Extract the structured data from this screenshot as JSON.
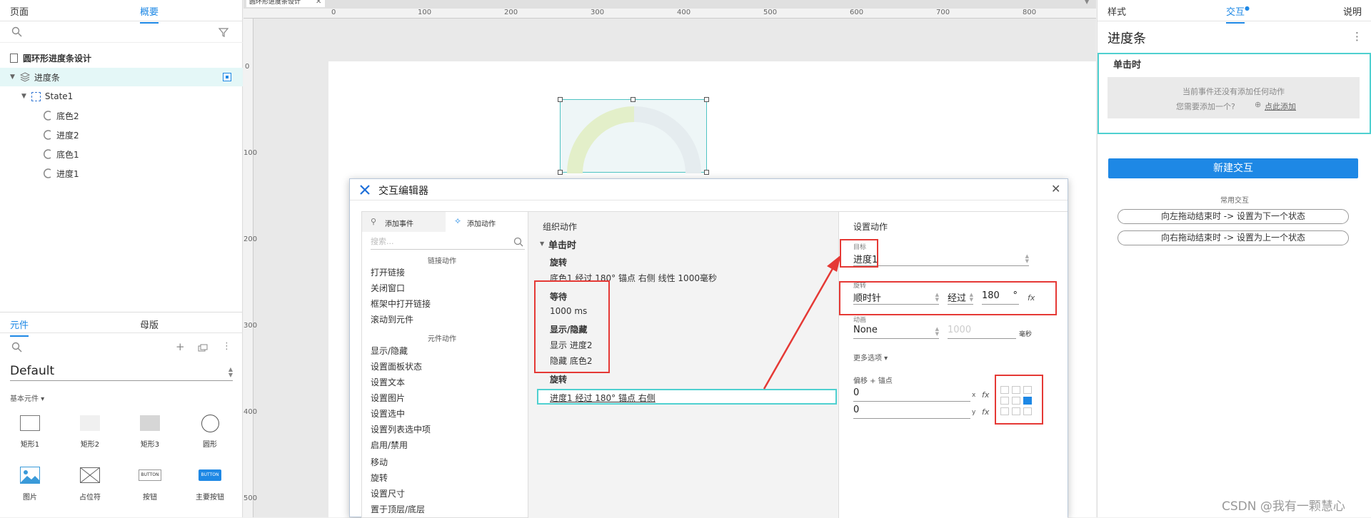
{
  "left_panel": {
    "tabs": [
      "页面",
      "概要"
    ],
    "outline": {
      "root": "圆环形进度条设计",
      "selected": "进度条",
      "state": "State1",
      "items": [
        "底色2",
        "进度2",
        "底色1",
        "进度1"
      ]
    },
    "library_tabs": [
      "元件",
      "母版"
    ],
    "library_name": "Default",
    "basic_label": "基本元件 ▾",
    "widgets": [
      "矩形1",
      "矩形2",
      "矩形3",
      "圆形",
      "图片",
      "占位符",
      "按钮",
      "主要按钮"
    ],
    "button_text": "BUTTON"
  },
  "canvas": {
    "doc_tab": "圆环形进度条设计",
    "ruler_h": [
      "0",
      "100",
      "200",
      "300",
      "400",
      "500",
      "600",
      "700",
      "800"
    ],
    "ruler_v": [
      "0",
      "100",
      "200",
      "300",
      "400",
      "500"
    ]
  },
  "dialog": {
    "title": "交互编辑器",
    "tabs": [
      "添加事件",
      "添加动作"
    ],
    "search_placeholder": "搜索...",
    "group_link": "链接动作",
    "link_actions": [
      "打开链接",
      "关闭窗口",
      "框架中打开链接",
      "滚动到元件"
    ],
    "group_widget": "元件动作",
    "widget_actions": [
      "显示/隐藏",
      "设置面板状态",
      "设置文本",
      "设置图片",
      "设置选中",
      "设置列表选中项",
      "启用/禁用",
      "移动",
      "旋转",
      "设置尺寸",
      "置于顶层/底层"
    ],
    "organize": {
      "header": "组织动作",
      "event": "单击时",
      "rotate1_title": "旋转",
      "rotate1_desc": "底色1 经过 180° 锚点 右侧 线性 1000毫秒",
      "wait_title": "等待",
      "wait_desc": "1000 ms",
      "show_title": "显示/隐藏",
      "show_desc1": "显示 进度2",
      "show_desc2": "隐藏 底色2",
      "rotate2_title": "旋转",
      "rotate2_desc": "进度1 经过 180° 锚点 右侧"
    },
    "settings": {
      "header": "设置动作",
      "target_label": "目标",
      "target_value": "进度1",
      "rotate_label": "旋转",
      "direction": "顺时针",
      "via": "经过",
      "degrees": "180",
      "deg_unit": "°",
      "anim_label": "动画",
      "anim_value": "None",
      "duration": "1000",
      "ms_unit": "毫秒",
      "more": "更多选项 ▾",
      "offset_label": "偏移 + 锚点",
      "x_value": "0",
      "y_value": "0",
      "x_axis": "x",
      "y_axis": "y",
      "fx": "fx"
    }
  },
  "right_panel": {
    "tabs": [
      "样式",
      "交互",
      "说明"
    ],
    "element_name": "进度条",
    "event": "单击时",
    "empty_msg": "当前事件还没有添加任何动作",
    "prompt": "您需要添加一个?",
    "add_link": "点此添加",
    "new_button": "新建交互",
    "common_label": "常用交互",
    "common_items": [
      "向左拖动结束时 -> 设置为下一个状态",
      "向右拖动结束时 -> 设置为上一个状态"
    ],
    "watermark": "CSDN @我有一颗慧心"
  },
  "colors": {
    "accent": "#1e88e5",
    "highlight": "#e53935",
    "teal": "#26c6c6"
  }
}
